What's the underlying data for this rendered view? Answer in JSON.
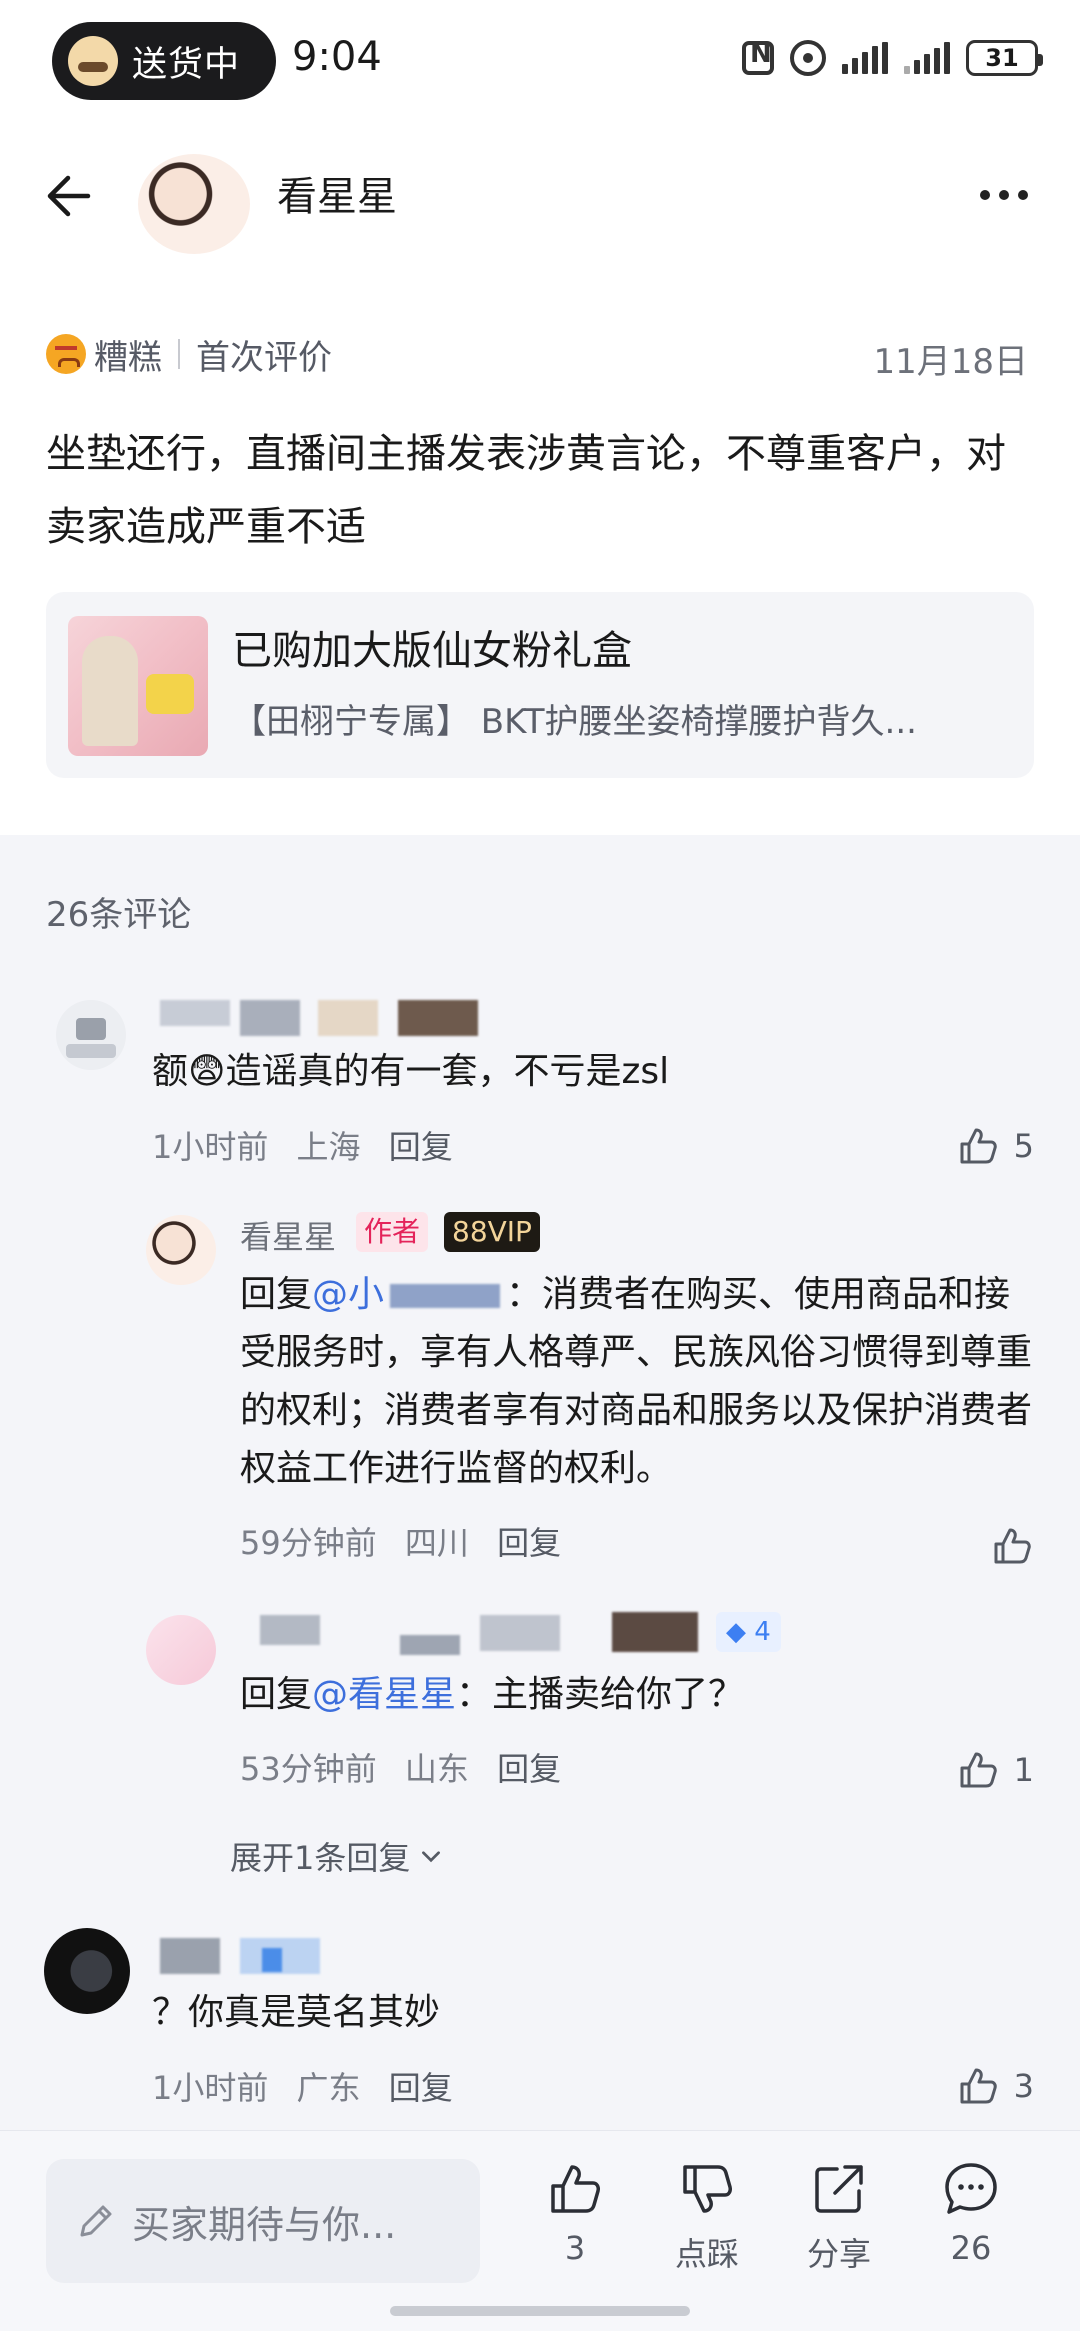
{
  "status_bar": {
    "pill_label": "送货中",
    "time": "9:04",
    "battery": "31"
  },
  "header": {
    "title": "看星星"
  },
  "review": {
    "rating_label": "糟糕",
    "type_label": "首次评价",
    "date": "11月18日",
    "text": "坐垫还行，直播间主播发表涉黄言论，不尊重客户，对卖家造成严重不适",
    "product": {
      "title": "已购加大版仙女粉礼盒",
      "subtitle": "【田栩宁专属】 BKT护腰坐姿椅撑腰护背久..."
    }
  },
  "comments_count": "26条评论",
  "comments": [
    {
      "text": "额😨造谣真的有一套，不亏是zsl",
      "time": "1小时前",
      "location": "上海",
      "reply_label": "回复",
      "likes": "5"
    }
  ],
  "replies": [
    {
      "name": "看星星",
      "author_badge": "作者",
      "vip_badge": "88VIP",
      "reply_prefix": "回复",
      "reply_target": "@小",
      "text": "：消费者在购买、使用商品和接受服务时，享有人格尊严、民族风俗习惯得到尊重的权利；消费者享有对商品和服务以及保护消费者权益工作进行监督的权利。",
      "time": "59分钟前",
      "location": "四川",
      "reply_label": "回复"
    },
    {
      "gem_badge": "4",
      "reply_prefix": "回复",
      "reply_target": "@看星星",
      "text": "：主播卖给你了？",
      "time": "53分钟前",
      "location": "山东",
      "reply_label": "回复",
      "likes": "1"
    }
  ],
  "expand_label": "展开1条回复",
  "comment2": {
    "text": "？你真是莫名其妙",
    "time": "1小时前",
    "location": "广东",
    "reply_label": "回复",
    "likes": "3"
  },
  "bottom_bar": {
    "input_placeholder": "买家期待与你...",
    "like_count": "3",
    "dislike_label": "点踩",
    "share_label": "分享",
    "comment_count": "26"
  }
}
